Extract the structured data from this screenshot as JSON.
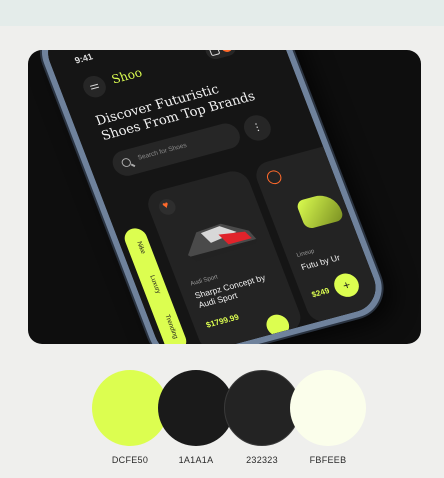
{
  "phone": {
    "status_time": "9:41",
    "brand": "Shoo",
    "headline": "Discover Futuristic Shoes From Top Brands",
    "search_placeholder": "Search for Shoes",
    "categories": [
      "Nike",
      "Luxury",
      "Trending"
    ],
    "products": [
      {
        "brand": "Audi Sport",
        "name": "Sharpz Concept by Audi Sport",
        "price": "$1799.99"
      },
      {
        "brand": "Lineup",
        "name": "Futu by Ur",
        "price": "$249"
      }
    ]
  },
  "palette": [
    {
      "hex": "#DCFE50",
      "label": "DCFE50"
    },
    {
      "hex": "#1A1A1A",
      "label": "1A1A1A"
    },
    {
      "hex": "#232323",
      "label": "232323"
    },
    {
      "hex": "#FBFEEB",
      "label": "FBFEEB"
    }
  ],
  "colors": {
    "accent": "#DCFE50",
    "badge": "#FF6A2B",
    "card_bg": "#0E0E0E"
  },
  "icons": {
    "menu": "menu-icon",
    "bag": "shopping-bag-icon",
    "search": "search-icon",
    "filter": "filter-icon",
    "heart": "heart-icon",
    "add": "plus-icon"
  }
}
